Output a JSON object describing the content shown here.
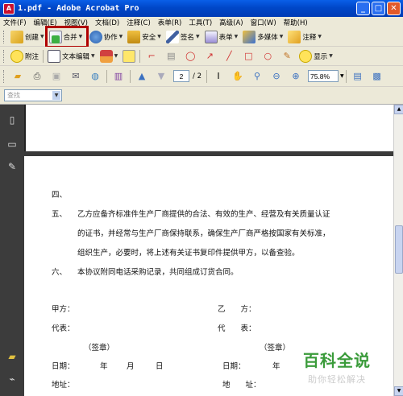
{
  "window": {
    "title": "1.pdf - Adobe Acrobat Pro",
    "app_icon": "pdf-icon"
  },
  "menu": [
    "文件(F)",
    "编辑(E)",
    "视图(V)",
    "文档(D)",
    "注释(C)",
    "表单(R)",
    "工具(T)",
    "高级(A)",
    "窗口(W)",
    "帮助(H)"
  ],
  "toolbar1": {
    "create": "创建",
    "combine": "合并",
    "collaborate": "协作",
    "secure": "安全",
    "sign": "签名",
    "forms": "表单",
    "multimedia": "多媒体",
    "comment": "注释"
  },
  "toolbar2": {
    "sticky_note": "附注",
    "text_edit": "文本编辑",
    "show": "显示"
  },
  "nav": {
    "current_page": "2",
    "total_pages": "/ 2",
    "zoom": "75.8%"
  },
  "search": {
    "placeholder": "查找"
  },
  "doc": {
    "l1": "四、",
    "l2a": "五、",
    "l2b": "乙方应备齐标准件生产厂商提供的合法、有效的生产、经营及有关质量认证",
    "l3": "的证书，并经常与生产厂商保持联系，确保生产厂商严格按国家有关标准，",
    "l4": "组织生产，必要时，将上述有关证书复印件提供甲方，以备查验。",
    "l5a": "六、",
    "l5b": "本协议附同电话采购记录，共同组成订货合同。",
    "party_a": "甲方：",
    "party_b": "乙　　方：",
    "rep_a": "代表：",
    "rep_b": "代　　表：",
    "sign_a": "（签章）",
    "sign_b": "（签章）",
    "date_a": "日期：",
    "year": "年",
    "month": "月",
    "day": "日",
    "date_b": "日期：",
    "year_b": "年",
    "addr_a": "地址：",
    "addr_b": "地　　址："
  },
  "watermark": {
    "title": "百科全说",
    "subtitle": "助你轻松解决"
  }
}
